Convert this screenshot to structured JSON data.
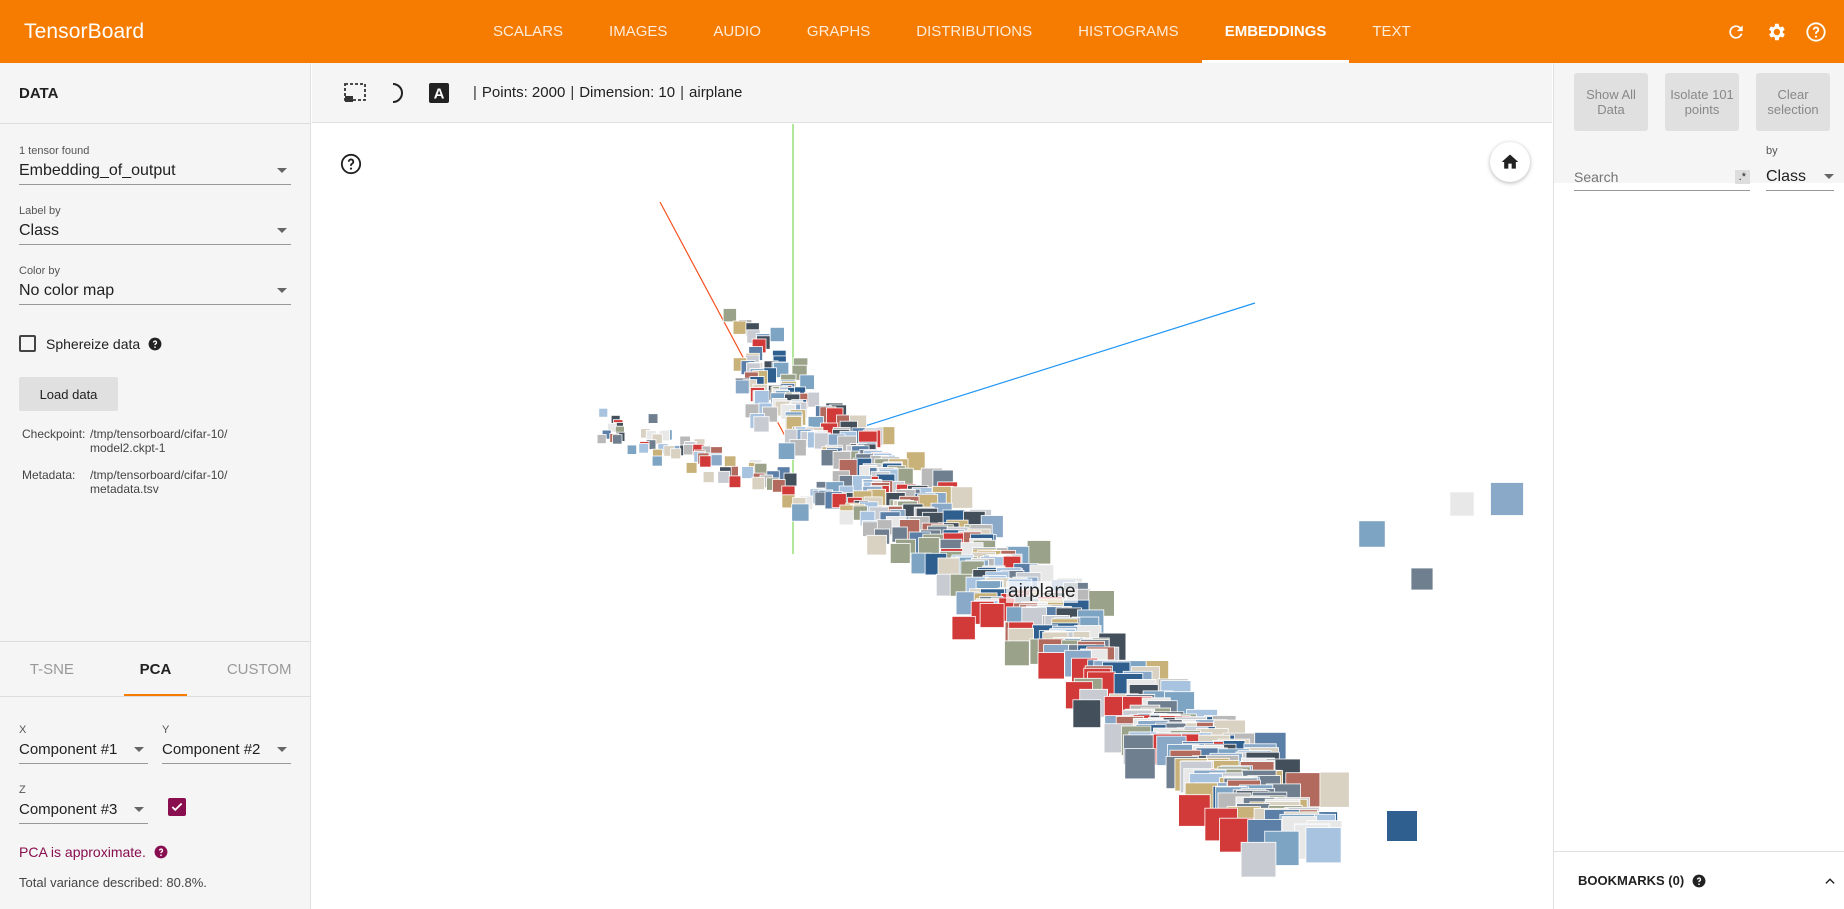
{
  "app": {
    "title": "TensorBoard"
  },
  "nav": {
    "tabs": [
      {
        "label": "SCALARS"
      },
      {
        "label": "IMAGES"
      },
      {
        "label": "AUDIO"
      },
      {
        "label": "GRAPHS"
      },
      {
        "label": "DISTRIBUTIONS"
      },
      {
        "label": "HISTOGRAMS"
      },
      {
        "label": "EMBEDDINGS"
      },
      {
        "label": "TEXT"
      }
    ],
    "active": "EMBEDDINGS",
    "icons": [
      "refresh-icon",
      "settings-icon",
      "help-icon"
    ]
  },
  "data_panel": {
    "title": "DATA",
    "tensor_count": "1 tensor found",
    "tensor_value": "Embedding_of_output",
    "label_by_label": "Label by",
    "label_by_value": "Class",
    "color_by_label": "Color by",
    "color_by_value": "No color map",
    "sphereize_label": "Sphereize data",
    "sphereize_checked": false,
    "load_button": "Load data",
    "checkpoint_key": "Checkpoint:",
    "checkpoint_value": "/tmp/tensorboard/cifar-10/ model2.ckpt-1",
    "metadata_key": "Metadata:",
    "metadata_value": "/tmp/tensorboard/cifar-10/ metadata.tsv"
  },
  "projection": {
    "tabs": [
      {
        "label": "T-SNE"
      },
      {
        "label": "PCA"
      },
      {
        "label": "CUSTOM"
      }
    ],
    "active": "PCA",
    "x_label": "X",
    "x_value": "Component #1",
    "y_label": "Y",
    "y_value": "Component #2",
    "z_label": "Z",
    "z_value": "Component #3",
    "z_enabled": true,
    "approx_text": "PCA is approximate.",
    "variance_text": "Total variance described: 80.8%."
  },
  "toolbar": {
    "points": "Points: 2000",
    "dimension": "Dimension: 10",
    "selected_label": "airplane"
  },
  "canvas": {
    "hover_label": "airplane"
  },
  "inspector": {
    "show_all": "Show All Data",
    "isolate": "Isolate 101 points",
    "clear": "Clear selection",
    "search_placeholder": "Search",
    "regex_toggle": ".*",
    "by_label": "by",
    "by_value": "Class",
    "bookmarks": "BOOKMARKS (0)"
  },
  "colors": {
    "accent": "#f57c00",
    "checkbox": "#880e4f",
    "approx_text": "#880e4f"
  }
}
